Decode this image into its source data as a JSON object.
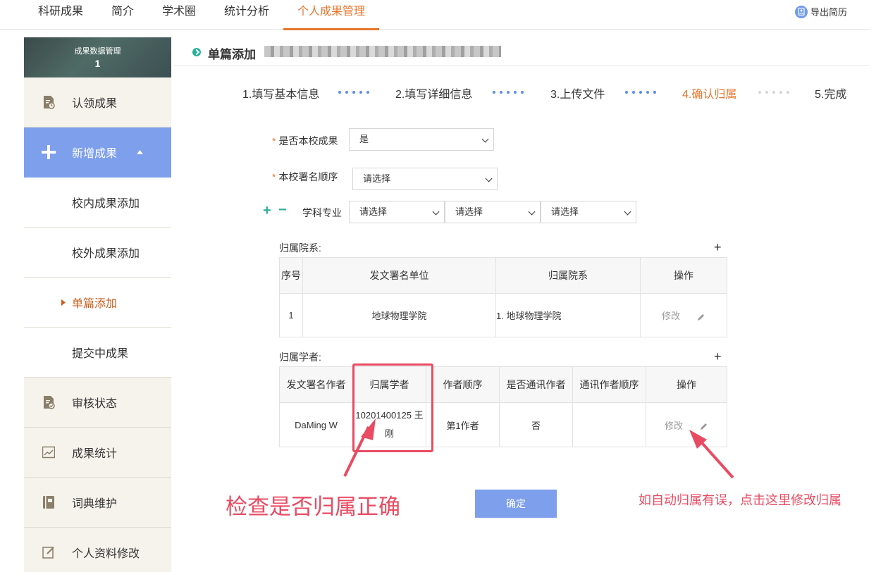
{
  "topnav": {
    "tabs": [
      "科研成果",
      "简介",
      "学术圈",
      "统计分析",
      "个人成果管理"
    ],
    "export_label": "导出简历"
  },
  "sidebar": {
    "header_title": "成果数据管理",
    "header_count": "1",
    "items": [
      {
        "label": "认领成果",
        "icon": "file-clock-icon"
      },
      {
        "label": "新增成果",
        "icon": "plus-icon"
      },
      {
        "label": "校内成果添加"
      },
      {
        "label": "校外成果添加"
      },
      {
        "label": "单篇添加"
      },
      {
        "label": "提交中成果"
      },
      {
        "label": "审核状态",
        "icon": "file-check-icon"
      },
      {
        "label": "成果统计",
        "icon": "chart-icon"
      },
      {
        "label": "词典维护",
        "icon": "book-icon"
      },
      {
        "label": "个人资料修改",
        "icon": "edit-icon"
      }
    ]
  },
  "page": {
    "title": "单篇添加"
  },
  "steps": [
    "1.填写基本信息",
    "2.填写详细信息",
    "3.上传文件",
    "4.确认归属",
    "5.完成"
  ],
  "form": {
    "is_school_label": "是否本校成果",
    "is_school_value": "是",
    "order_label": "本校署名顺序",
    "order_value": "请选择",
    "discipline_label": "学科专业",
    "discipline_values": [
      "请选择",
      "请选择",
      "请选择"
    ]
  },
  "dept": {
    "label": "归属院系:",
    "headers": [
      "序号",
      "发文署名单位",
      "归属院系",
      "操作"
    ],
    "rows": [
      {
        "no": "1",
        "unit": "地球物理学院",
        "dept": "1. 地球物理学院",
        "action": "修改"
      }
    ]
  },
  "scholar": {
    "label": "归属学者:",
    "headers": [
      "发文署名作者",
      "归属学者",
      "作者顺序",
      "是否通讯作者",
      "通讯作者顺序",
      "操作"
    ],
    "rows": [
      {
        "author": "DaMing W",
        "scholar": "10201400125 王刚",
        "order": "第1作者",
        "corr": "否",
        "corr_order": "",
        "action": "修改"
      }
    ]
  },
  "confirm_label": "确定",
  "annotations": {
    "left": "检查是否归属正确",
    "right": "如自动归属有误，点击这里修改归属"
  },
  "colors": {
    "accent": "#e8752b",
    "primary": "#7d9fec",
    "annotation": "#e94b62",
    "green": "#29b09a"
  }
}
